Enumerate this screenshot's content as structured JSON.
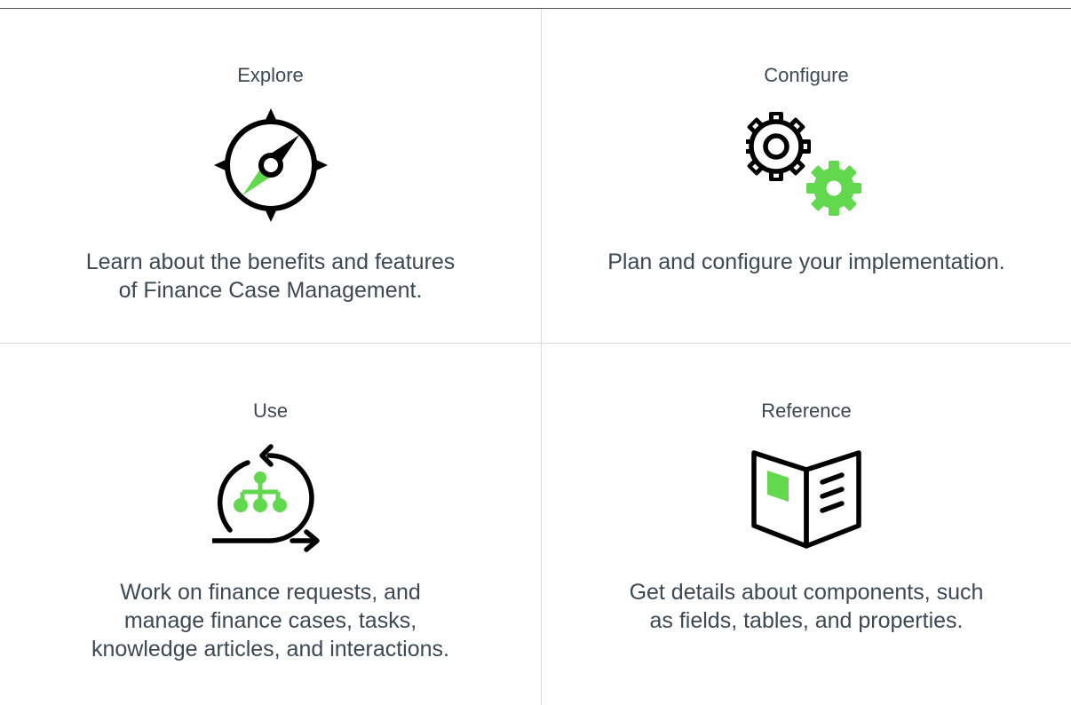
{
  "cards": [
    {
      "title": "Explore",
      "icon": "compass-icon",
      "description_lines": [
        "Learn about the benefits and features",
        "of Finance Case Management."
      ]
    },
    {
      "title": "Configure",
      "icon": "gears-icon",
      "description_lines": [
        "Plan and configure your implementation."
      ]
    },
    {
      "title": "Use",
      "icon": "workflow-cycle-icon",
      "description_lines": [
        "Work on finance requests, and",
        "manage finance cases, tasks,",
        "knowledge articles, and interactions."
      ]
    },
    {
      "title": "Reference",
      "icon": "open-book-icon",
      "description_lines": [
        "Get details about components, such",
        "as fields, tables, and properties."
      ]
    }
  ],
  "colors": {
    "text": "#3c4852",
    "icon_stroke": "#000000",
    "accent_green": "#62d84e",
    "divider": "#d8dadc",
    "top_rule": "#5a5f64"
  }
}
